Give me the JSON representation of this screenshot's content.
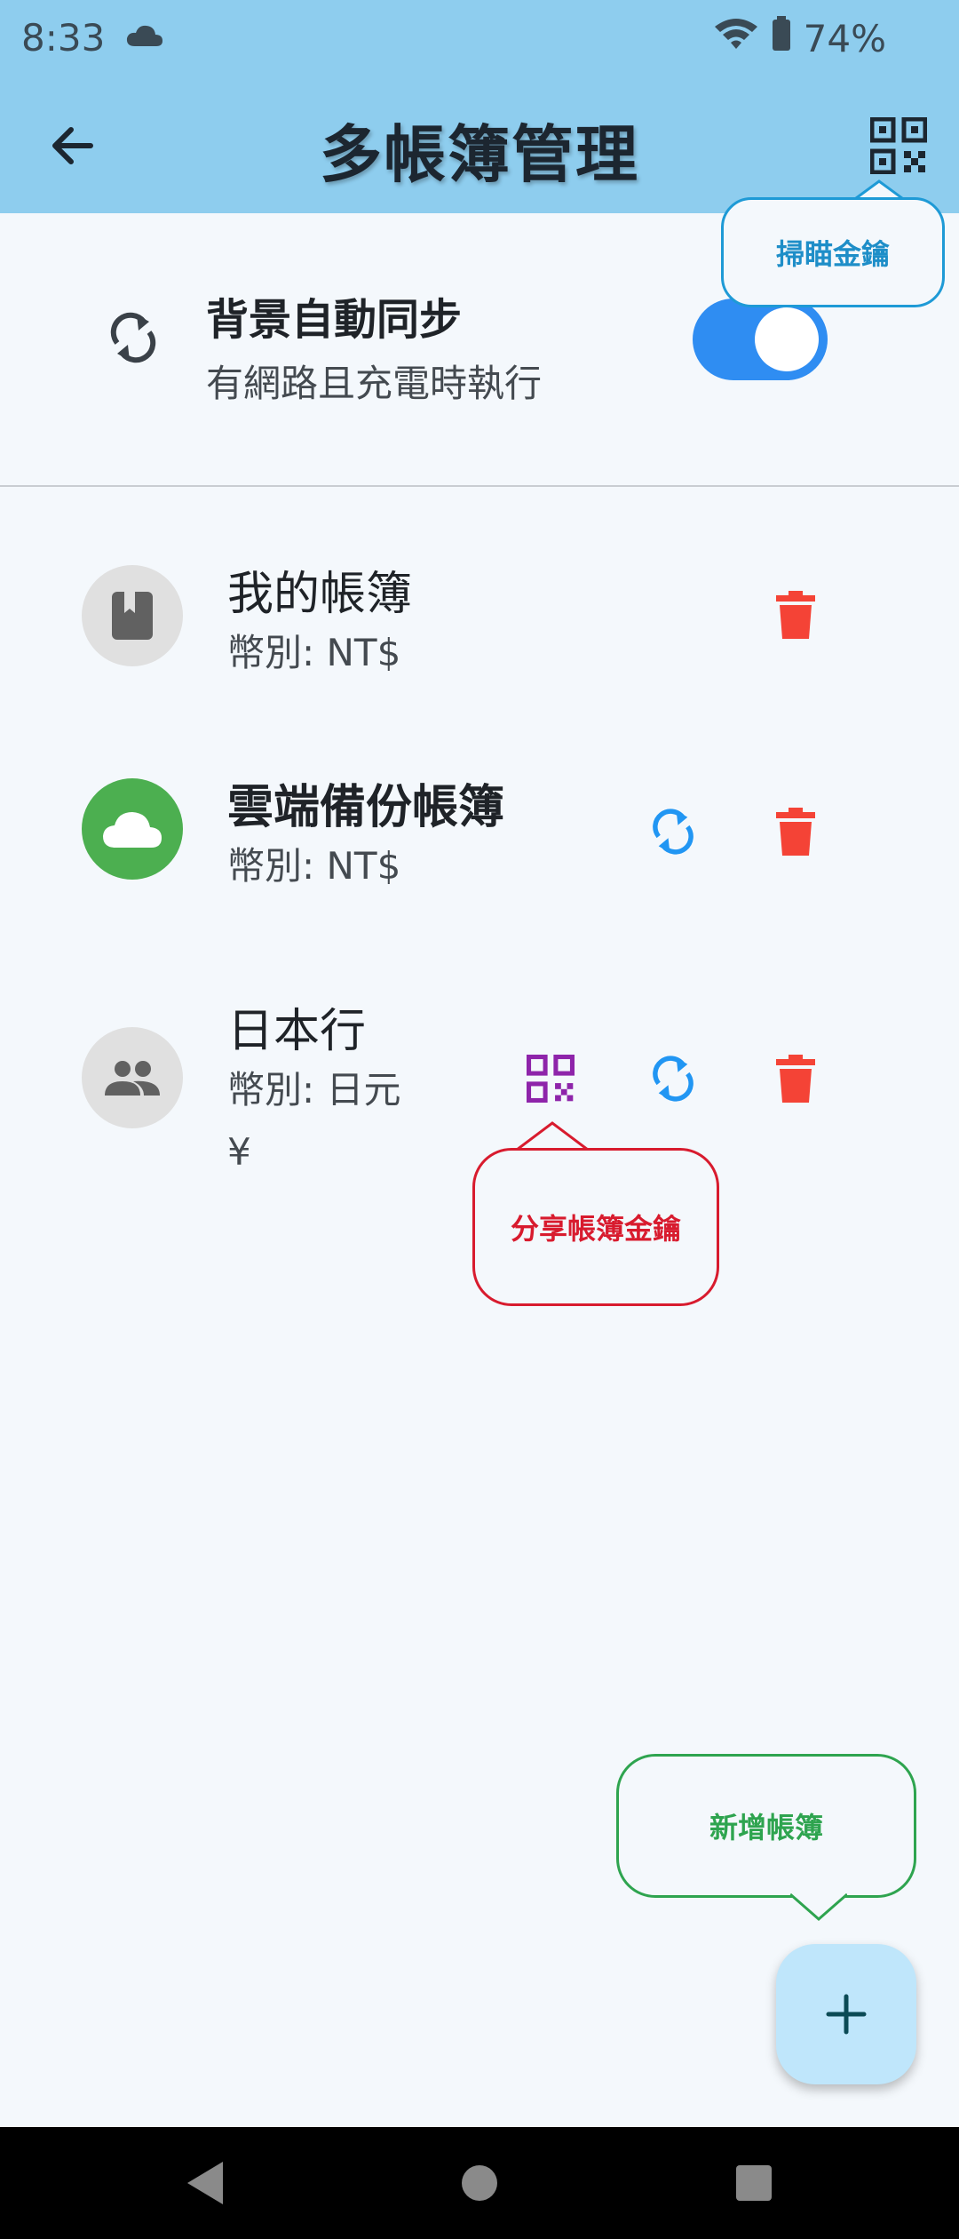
{
  "status_bar": {
    "time": "8:33",
    "battery": "74%"
  },
  "app_bar": {
    "title": "多帳簿管理"
  },
  "callouts": {
    "scan": "掃瞄金鑰",
    "share": "分享帳簿金鑰",
    "add": "新增帳簿"
  },
  "sync": {
    "title": "背景自動同步",
    "subtitle": "有網路且充電時執行",
    "enabled": true
  },
  "books": [
    {
      "name": "我的帳簿",
      "currency": "幣別: NT$"
    },
    {
      "name": "雲端備份帳簿",
      "currency": "幣別: NT$"
    },
    {
      "name": "日本行",
      "currency": "幣別: 日元 ¥"
    }
  ],
  "colors": {
    "app_bar": "#8ecdee",
    "toggle_on": "#2f8df2",
    "delete": "#f44336",
    "sync_icon": "#2196f3",
    "share_qr": "#8e24aa",
    "cloud_avatar": "#4caf50",
    "fab": "#bfe6fb"
  },
  "icons": {
    "back": "arrow-left-icon",
    "scan": "qr-scan-icon",
    "sync": "sync-icon",
    "book": "book-icon",
    "cloud": "cloud-icon",
    "group": "group-icon",
    "delete": "trash-icon",
    "share": "qr-code-icon",
    "add": "plus-icon"
  }
}
